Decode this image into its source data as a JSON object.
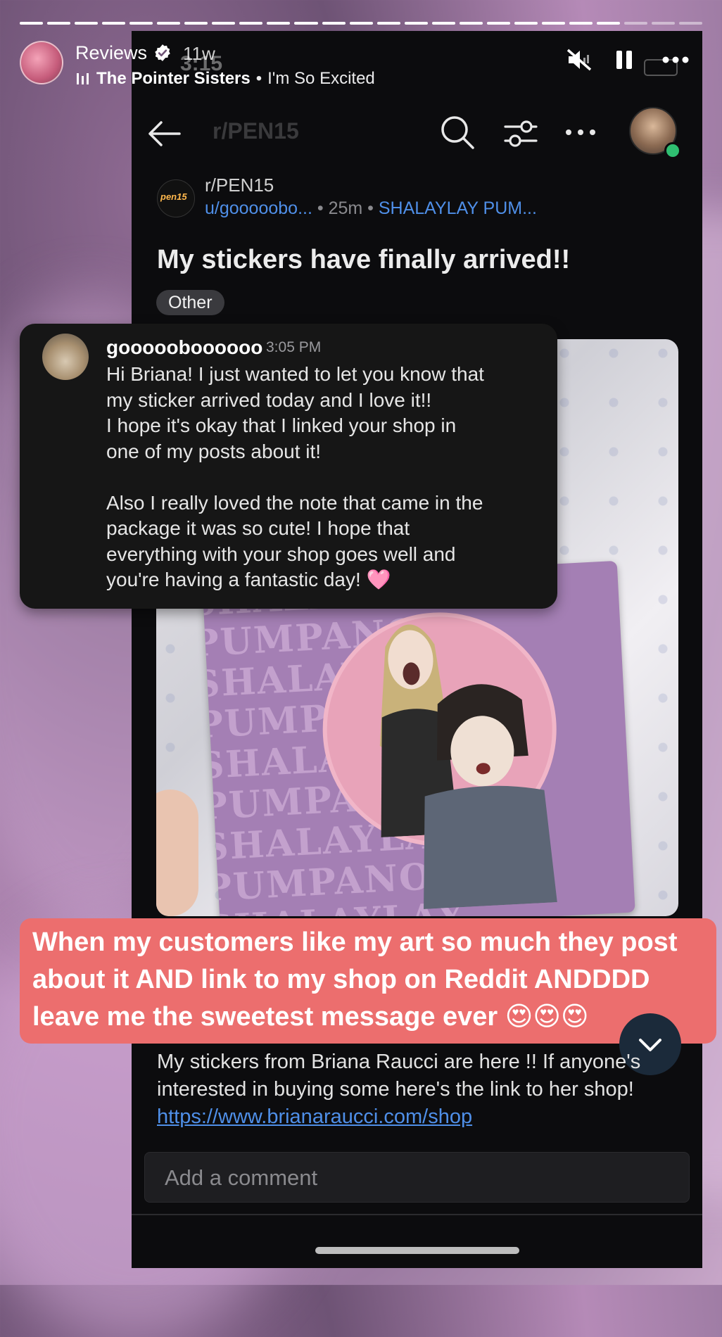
{
  "story": {
    "account_name": "Reviews",
    "age": "11w",
    "music_artist": "The Pointer Sisters",
    "music_separator": "•",
    "music_song": "I'm So Excited"
  },
  "status_bar": {
    "time": "3:15"
  },
  "reddit_nav": {
    "subreddit_title": "r/PEN15"
  },
  "post": {
    "subreddit": "r/PEN15",
    "sub_icon_text": "pen15",
    "username": "u/gooooobo...",
    "age": "• 25m •",
    "flair_user": "SHALAYLAY PUM...",
    "title": "My stickers have finally arrived!!",
    "flair": "Other",
    "body_text": "My stickers from Briana Raucci are here !! If anyone's interested in buying some here's the link to her shop! ",
    "link": "https://www.brianaraucci.com/shop"
  },
  "sticker": {
    "text_lines": [
      "SHALAYLAY PUMPANO",
      "SHALAYLAY PUMPANO",
      "SHALAYLAY PUMPANO",
      "SHALAYLAY PUMPANO",
      "SHALAYLAY PUMPANO",
      "SHALAYLAY PUMPANO",
      "SHALAYLAY PUMPANO",
      "SHALAYLAY PUMPANO"
    ]
  },
  "dm": {
    "sender": "goooooboooooo",
    "time": "3:05 PM",
    "message": "Hi Briana! I just wanted to let you know that\nmy sticker arrived today and I love it!!\nI hope it's okay that I linked your shop in\none of my posts about it!\n\nAlso I really loved the note that came in the\npackage it was so cute! I hope that\neverything with your shop goes well and\nyou're having a fantastic day! 🩷"
  },
  "caption": {
    "text": "When my customers like my art so much they post\nabout it AND link to my shop on Reddit ANDDDD\nleave me the sweetest message ever 😍😍😍"
  },
  "comment": {
    "placeholder": "Add a comment"
  },
  "colors": {
    "caption_bg": "#ec6e6e",
    "link": "#4f8fe8",
    "online": "#2fbf71",
    "panel_bg": "#0c0c0e"
  },
  "icons": [
    "verified-icon",
    "music-icon",
    "mute-icon",
    "pause-icon",
    "more-icon",
    "back-arrow-icon",
    "search-icon",
    "filter-icon",
    "more-dots-icon",
    "chevron-down-icon"
  ]
}
